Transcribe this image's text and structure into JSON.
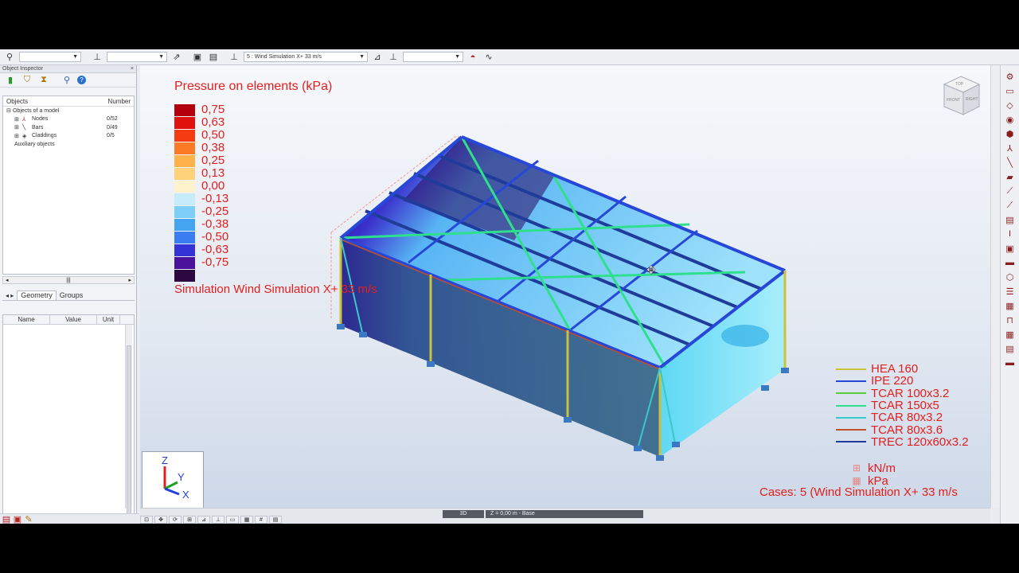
{
  "toolbar": {
    "view_combo": "",
    "structure_combo": "",
    "case_combo": "5 : Wind Simulation X+ 33 m/s",
    "extra_combo": ""
  },
  "inspector": {
    "title": "Object Inspector",
    "close": "×",
    "tree_header": {
      "objects": "Objects",
      "number": "Number"
    },
    "tree": [
      {
        "label": "Objects of a model",
        "count": ""
      },
      {
        "label": "Nodes",
        "count": "0/52"
      },
      {
        "label": "Bars",
        "count": "0/49"
      },
      {
        "label": "Claddings",
        "count": "0/5"
      },
      {
        "label": "Auxiliary objects",
        "count": ""
      }
    ],
    "tabs": [
      "Geometry",
      "Groups"
    ],
    "props_cols": [
      "Name",
      "Value",
      "Unit"
    ]
  },
  "legend": {
    "title": "Pressure on elements (kPa)",
    "scale": [
      {
        "label": "0,75",
        "color": "#b2000c"
      },
      {
        "label": "0,63",
        "color": "#e0120e"
      },
      {
        "label": "0,50",
        "color": "#f53b12"
      },
      {
        "label": "0,38",
        "color": "#fb7a26"
      },
      {
        "label": "0,25",
        "color": "#fdb34a"
      },
      {
        "label": "0,13",
        "color": "#fdd27a"
      },
      {
        "label": "0,00",
        "color": "#fdf2cc"
      },
      {
        "label": "-0,13",
        "color": "#c6ecfa"
      },
      {
        "label": "-0,25",
        "color": "#7dcff7"
      },
      {
        "label": "-0,38",
        "color": "#44a4f0"
      },
      {
        "label": "-0,50",
        "color": "#3a7ef2"
      },
      {
        "label": "-0,63",
        "color": "#3433d6"
      },
      {
        "label": "-0,75",
        "color": "#4b139c"
      },
      {
        "label": "",
        "color": "#2c0840"
      }
    ],
    "simulation": "Simulation Wind Simulation X+ 33 m/s"
  },
  "sections": [
    {
      "label": "HEA 160",
      "color": "#c9c23a"
    },
    {
      "label": "IPE 220",
      "color": "#2747d8"
    },
    {
      "label": "TCAR 100x3.2",
      "color": "#5bcc3c"
    },
    {
      "label": "TCAR 150x5",
      "color": "#2ee08e"
    },
    {
      "label": "TCAR 80x3.2",
      "color": "#3ac8c8"
    },
    {
      "label": "TCAR 80x3.6",
      "color": "#c0502a"
    },
    {
      "label": "TREC 120x60x3.2",
      "color": "#1f3c9a"
    }
  ],
  "units": [
    "kN/m",
    "kPa"
  ],
  "cases": "Cases: 5 (Wind Simulation X+ 33 m/s",
  "axes": {
    "z": "Z",
    "y": "Y",
    "x": "X"
  },
  "viewcube": {
    "top": "TOP",
    "front": "FRONT",
    "right": "RIGHT"
  },
  "status": {
    "view_mode": "3D",
    "level": "Z = 0,00 m - Base"
  },
  "icons": {
    "toolbar": [
      "display-icon",
      "structure-icon",
      "select-icon",
      "save-view-icon",
      "print-icon",
      "case-icon",
      "load-icon",
      "results-icon",
      "diagram-icon",
      "deformation-icon"
    ],
    "right": [
      "nodes-icon",
      "bars-icon",
      "supports-icon",
      "sections-icon",
      "materials-icon",
      "loads-icon",
      "combinations-icon",
      "results-icon",
      "tables-icon"
    ]
  }
}
